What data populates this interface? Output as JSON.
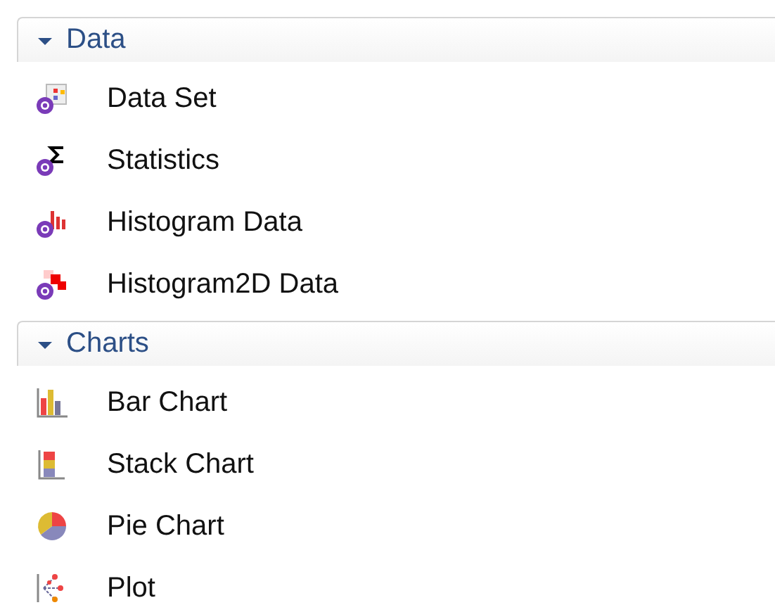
{
  "sections": [
    {
      "title": "Data",
      "expanded": true,
      "items": [
        {
          "label": "Data Set",
          "kind": "dataset"
        },
        {
          "label": "Statistics",
          "kind": "statistics"
        },
        {
          "label": "Histogram Data",
          "kind": "histogram"
        },
        {
          "label": "Histogram2D Data",
          "kind": "histogram2d"
        }
      ]
    },
    {
      "title": "Charts",
      "expanded": true,
      "items": [
        {
          "label": "Bar Chart",
          "kind": "bar"
        },
        {
          "label": "Stack Chart",
          "kind": "stack"
        },
        {
          "label": "Pie Chart",
          "kind": "pie"
        },
        {
          "label": "Plot",
          "kind": "plot"
        }
      ]
    }
  ]
}
